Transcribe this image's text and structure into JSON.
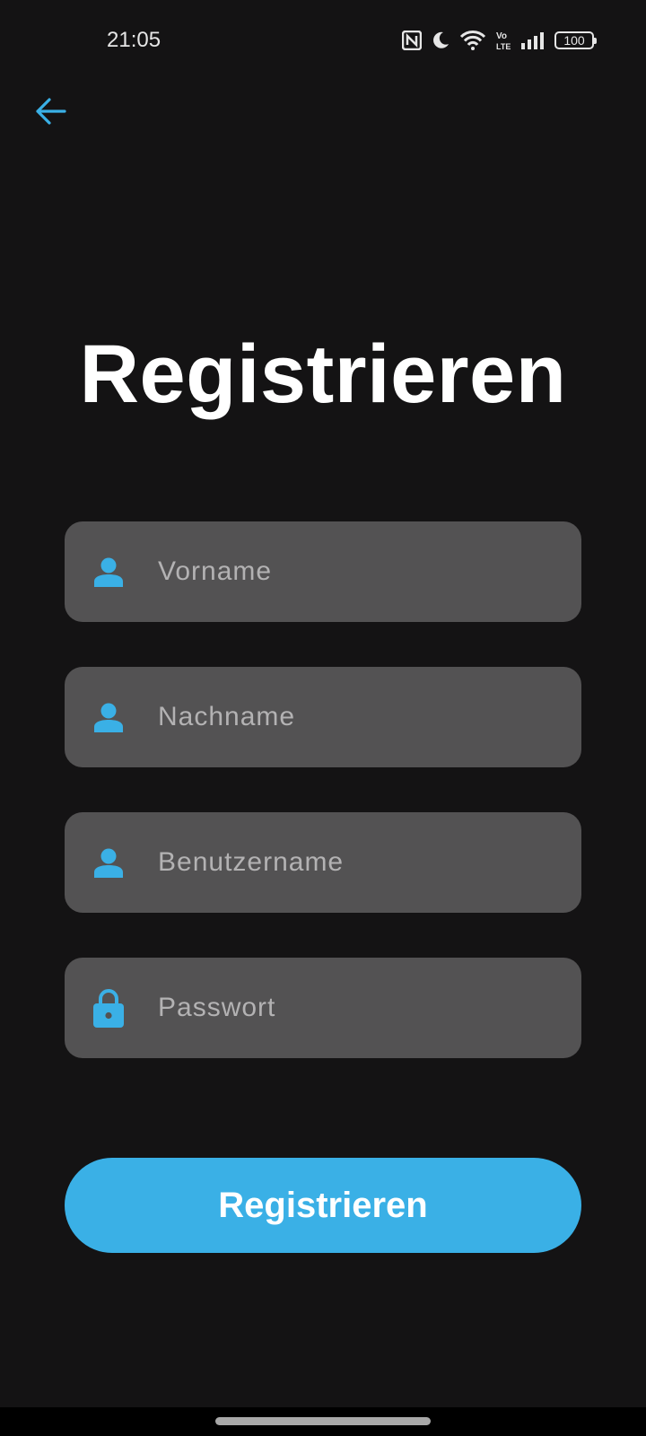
{
  "status_bar": {
    "time": "21:05",
    "battery": "100",
    "icons": [
      "nfc-icon",
      "moon-icon",
      "wifi-icon",
      "volte-icon",
      "signal-icon",
      "battery-icon"
    ]
  },
  "header": {
    "back_icon": "arrow-left-icon"
  },
  "page": {
    "title": "Registrieren"
  },
  "form": {
    "first_name": {
      "placeholder": "Vorname",
      "value": "",
      "icon": "person-icon"
    },
    "last_name": {
      "placeholder": "Nachname",
      "value": "",
      "icon": "person-icon"
    },
    "username": {
      "placeholder": "Benutzername",
      "value": "",
      "icon": "person-icon"
    },
    "password": {
      "placeholder": "Passwort",
      "value": "",
      "icon": "lock-icon"
    },
    "submit_label": "Registrieren"
  },
  "colors": {
    "background": "#141314",
    "accent": "#3ab0e6",
    "field_background": "#535253",
    "placeholder": "#b3b2b3"
  }
}
